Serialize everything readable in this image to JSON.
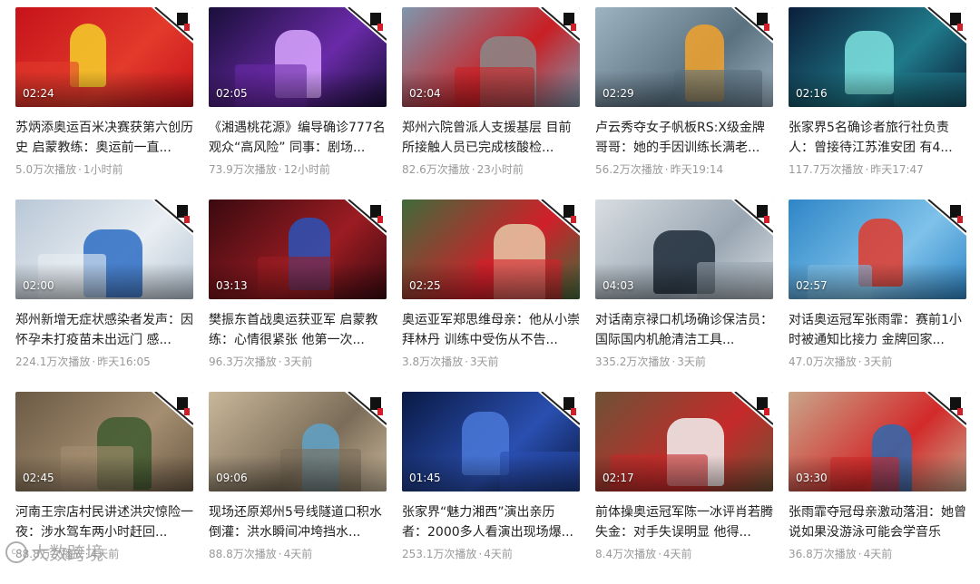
{
  "videos": [
    {
      "duration": "02:24",
      "title": "苏炳添奥运百米决赛获第六创历史 启蒙教练：奥运前一直...",
      "plays": "5.0万次播放",
      "time": "1小时前",
      "palette": [
        "#c7131b",
        "#e23a2b",
        "#f5d02a"
      ]
    },
    {
      "duration": "02:05",
      "title": "《湘遇桃花源》编导确诊777名观众“高风险” 同事：剧场...",
      "plays": "73.9万次播放",
      "time": "12小时前",
      "palette": [
        "#1a0f3a",
        "#6a2aa8",
        "#d9a6ff"
      ]
    },
    {
      "duration": "02:04",
      "title": "郑州六院曾派人支援基层 目前所接触人员已完成核酸检...",
      "plays": "82.6万次播放",
      "time": "23小时前",
      "palette": [
        "#7f97ad",
        "#c91f24",
        "#8a8a8a"
      ]
    },
    {
      "duration": "02:29",
      "title": "卢云秀夺女子帆板RS:X级金牌 哥哥：她的手因训练长满老...",
      "plays": "56.2万次播放",
      "time": "昨天19:14",
      "palette": [
        "#9eb3c2",
        "#5a7180",
        "#f1a22b"
      ]
    },
    {
      "duration": "02:16",
      "title": "张家界5名确诊者旅行社负责人：曾接待江苏淮安团 有4...",
      "plays": "117.7万次播放",
      "time": "昨天17:47",
      "palette": [
        "#0b1e3a",
        "#1f7a8a",
        "#7fe3e0"
      ]
    },
    {
      "duration": "02:00",
      "title": "郑州新增无症状感染者发声：因怀孕未打疫苗未出远门 感...",
      "plays": "224.1万次播放",
      "time": "昨天16:05",
      "palette": [
        "#b9c7d6",
        "#e8eef3",
        "#2b6cc4"
      ]
    },
    {
      "duration": "03:13",
      "title": "樊振东首战奥运获亚军 启蒙教练：心情很紧张 他第一次...",
      "plays": "96.3万次播放",
      "time": "3天前",
      "palette": [
        "#3a0a10",
        "#9b1c22",
        "#2a52b8"
      ]
    },
    {
      "duration": "02:25",
      "title": "奥运亚军郑思维母亲：他从小崇拜林丹 训练中受伤从不告...",
      "plays": "3.8万次播放",
      "time": "3天前",
      "palette": [
        "#3f6b3a",
        "#d11f2a",
        "#e8c9a8"
      ]
    },
    {
      "duration": "04:03",
      "title": "对话南京禄口机场确诊保洁员：国际国内机舱清洁工具...",
      "plays": "335.2万次播放",
      "time": "3天前",
      "palette": [
        "#d8dde2",
        "#9aa7b3",
        "#1f2b38"
      ]
    },
    {
      "duration": "02:57",
      "title": "对话奥运冠军张雨霏：赛前1小时被通知比接力 金牌回家...",
      "plays": "47.0万次播放",
      "time": "3天前",
      "palette": [
        "#2e86c7",
        "#7fc2ea",
        "#e23a2b"
      ]
    },
    {
      "duration": "02:45",
      "title": "河南王宗店村民讲述洪灾惊险一夜：涉水驾车两小时赶回...",
      "plays": "88.8万次播放",
      "time": "4天前",
      "palette": [
        "#6b5a45",
        "#a58e70",
        "#3f5a2f"
      ]
    },
    {
      "duration": "09:06",
      "title": "现场还原郑州5号线隧道口积水倒灌：洪水瞬间冲垮挡水...",
      "plays": "88.8万次播放",
      "time": "4天前",
      "palette": [
        "#c9b79a",
        "#7a6c58",
        "#5fa2c8"
      ]
    },
    {
      "duration": "01:45",
      "title": "张家界“魅力湘西”演出亲历者：2000多人看演出现场爆...",
      "plays": "253.1万次播放",
      "time": "4天前",
      "palette": [
        "#0a1a45",
        "#2a4fb0",
        "#4a78d8"
      ]
    },
    {
      "duration": "02:17",
      "title": "前体操奥运冠军陈一冰评肖若腾失金：对手失误明显 他得...",
      "plays": "8.4万次播放",
      "time": "4天前",
      "palette": [
        "#6d5236",
        "#c52a2a",
        "#f2f2f2"
      ]
    },
    {
      "duration": "03:30",
      "title": "张雨霏夺冠母亲激动落泪：她曾说如果没游泳可能会学音乐",
      "plays": "36.8万次播放",
      "time": "4天前",
      "palette": [
        "#c9a58a",
        "#d22a2a",
        "#2f6ab0"
      ]
    }
  ],
  "watermark": {
    "text": "大数跨境",
    "logo": "cc"
  }
}
